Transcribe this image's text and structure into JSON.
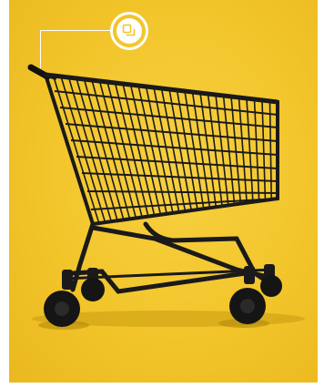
{
  "image": {
    "subject": "shopping-cart",
    "background_color": "#f2c52b"
  },
  "hotspot": {
    "icon": "stack-icon",
    "ring_color": "#ffffff"
  }
}
